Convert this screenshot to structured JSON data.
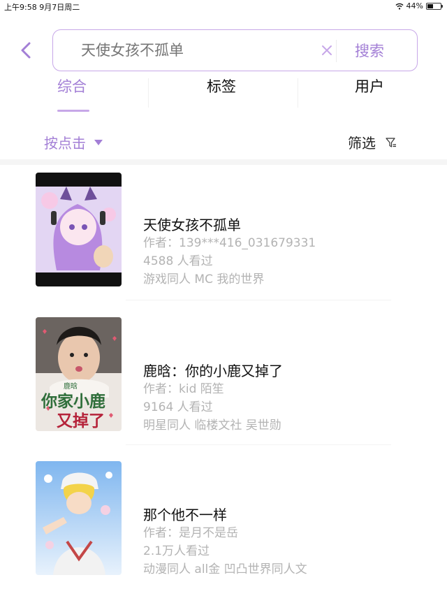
{
  "status_bar": {
    "time_date": "上午9:58   9月7日周二",
    "battery": "44%",
    "battery_level": 0.44
  },
  "search": {
    "placeholder": "天使女孩不孤单",
    "button_label": "搜索"
  },
  "tabs": [
    {
      "label": "综合",
      "active": true
    },
    {
      "label": "标签",
      "active": false
    },
    {
      "label": "用户",
      "active": false
    }
  ],
  "filter_bar": {
    "sort_label": "按点击",
    "filter_label": "筛选"
  },
  "results": [
    {
      "title": "天使女孩不孤单",
      "author": "作者：139***416_031679331",
      "views": "4588 人看过",
      "tags": "游戏同人 MC 我的世界"
    },
    {
      "title": "鹿晗：你的小鹿又掉了",
      "author": "作者：kid 陌笙",
      "views": "9164 人看过",
      "tags": "明星同人 临楼文社 吴世勋",
      "cover_text_small": "鹿晗",
      "cover_text_large": "你家小鹿",
      "cover_text_large2": "又掉了"
    },
    {
      "title": "那个他不一样",
      "author": "作者：是月不是岳",
      "views": "2.1万人看过",
      "tags": "动漫同人 all金 凹凸世界同人文"
    }
  ],
  "colors": {
    "accent": "#a37fd6",
    "accent_light": "#c7a7e8",
    "meta_text": "#b3b3b3"
  }
}
